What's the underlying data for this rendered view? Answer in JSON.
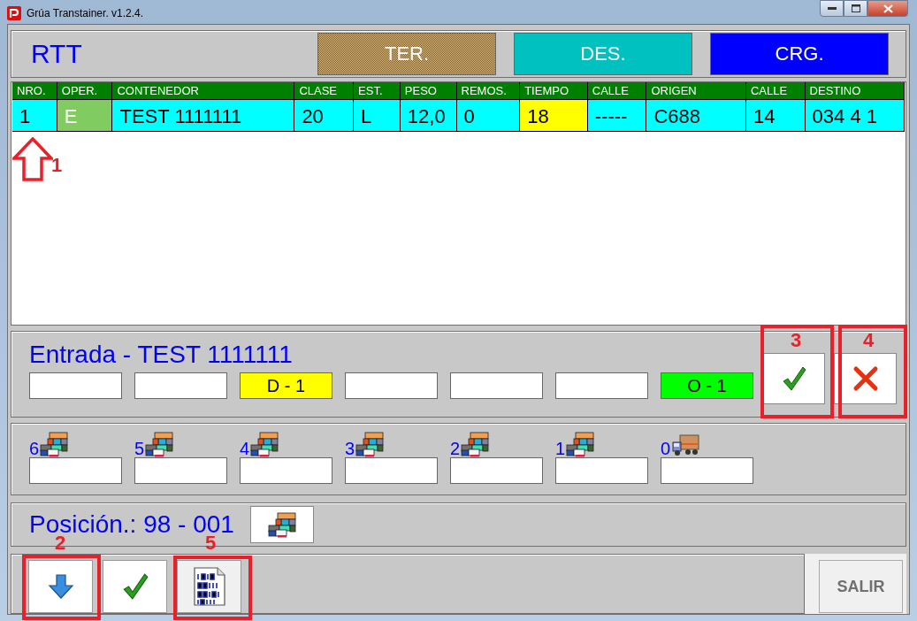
{
  "window": {
    "title": "Grúa Transtainer. v1.2.4."
  },
  "header": {
    "title": "RTT",
    "mode_buttons": [
      {
        "label": "TER.",
        "kind": "hatched"
      },
      {
        "label": "DES.",
        "kind": "teal"
      },
      {
        "label": "CRG.",
        "kind": "blue"
      }
    ]
  },
  "table": {
    "columns": [
      "NRO.",
      "OPER.",
      "CONTENEDOR",
      "CLASE",
      "EST.",
      "PESO",
      "REMOS.",
      "TIEMPO",
      "CALLE",
      "ORIGEN",
      "CALLE",
      "DESTINO"
    ],
    "rows": [
      {
        "cells": [
          {
            "text": "1"
          },
          {
            "text": "E",
            "color": "#80cc60"
          },
          {
            "text": "TEST 1111111"
          },
          {
            "text": "20"
          },
          {
            "text": "L"
          },
          {
            "text": "12,0"
          },
          {
            "text": "0"
          },
          {
            "text": "18",
            "color": "#ffff00"
          },
          {
            "text": "-----"
          },
          {
            "text": "C688"
          },
          {
            "text": "14"
          },
          {
            "text": "034 4 1"
          }
        ]
      }
    ]
  },
  "entry": {
    "title": "Entrada - TEST 1111111",
    "slots": [
      {
        "kind": "empty"
      },
      {
        "kind": "empty"
      },
      {
        "kind": "filled",
        "text": "D - 1",
        "color": "#ffff00"
      },
      {
        "kind": "empty"
      },
      {
        "kind": "empty"
      },
      {
        "kind": "empty"
      },
      {
        "kind": "filled",
        "text": "O - 1",
        "color": "#00ff00"
      }
    ]
  },
  "tiers": [
    {
      "label": "6",
      "kind": "stack"
    },
    {
      "label": "5",
      "kind": "stack"
    },
    {
      "label": "4",
      "kind": "stack"
    },
    {
      "label": "3",
      "kind": "stack"
    },
    {
      "label": "2",
      "kind": "stack"
    },
    {
      "label": "1",
      "kind": "stack"
    },
    {
      "label": "0",
      "kind": "truck"
    }
  ],
  "position": {
    "text": "Posición.: 98 - 001"
  },
  "exit_button": {
    "label": "SALIR"
  },
  "annotations": [
    {
      "label": "1",
      "kind": "arrow"
    },
    {
      "label": "2",
      "kind": "box"
    },
    {
      "label": "3",
      "kind": "box"
    },
    {
      "label": "4",
      "kind": "box"
    },
    {
      "label": "5",
      "kind": "box"
    }
  ]
}
